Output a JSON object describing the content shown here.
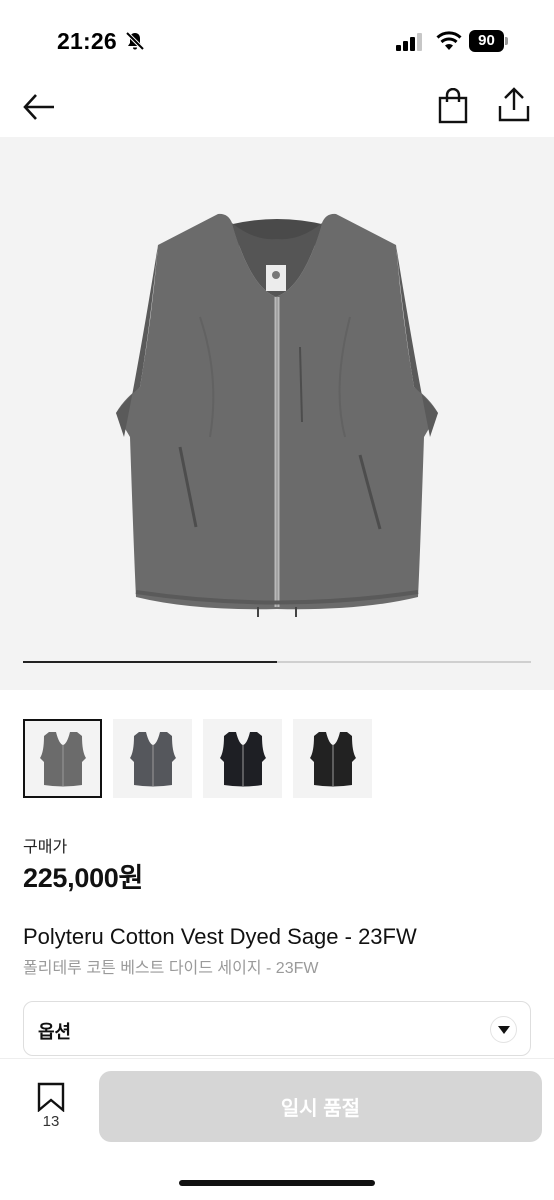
{
  "status_bar": {
    "time": "21:26",
    "battery": "90",
    "mute_icon": "bell-slash-icon",
    "signal_icon": "cellular-signal-icon",
    "wifi_icon": "wifi-icon"
  },
  "nav": {
    "back_icon": "arrow-left-icon",
    "bag_icon": "shopping-bag-icon",
    "share_icon": "share-icon"
  },
  "gallery": {
    "image_count": 2,
    "current_index": 1,
    "progress": 0.5,
    "thumbnails": [
      {
        "color": "#6b6b6b",
        "selected": true
      },
      {
        "color": "#55575c",
        "selected": false
      },
      {
        "color": "#1e1f24",
        "selected": false
      },
      {
        "color": "#222222",
        "selected": false
      }
    ]
  },
  "product": {
    "price_label": "구매가",
    "price": "225,000원",
    "title_en": "Polyteru Cotton Vest Dyed Sage - 23FW",
    "title_ko": "폴리테루 코튼 베스트 다이드 세이지 - 23FW"
  },
  "option": {
    "label": "옵션",
    "icon": "chevron-down-icon"
  },
  "bottom_bar": {
    "bookmark_icon": "bookmark-icon",
    "bookmark_count": "13",
    "button_label": "일시 품절"
  },
  "colors": {
    "button_disabled": "#d6d6d6",
    "hero_background": "#f3f3f3",
    "vest": "#6b6b6b"
  }
}
